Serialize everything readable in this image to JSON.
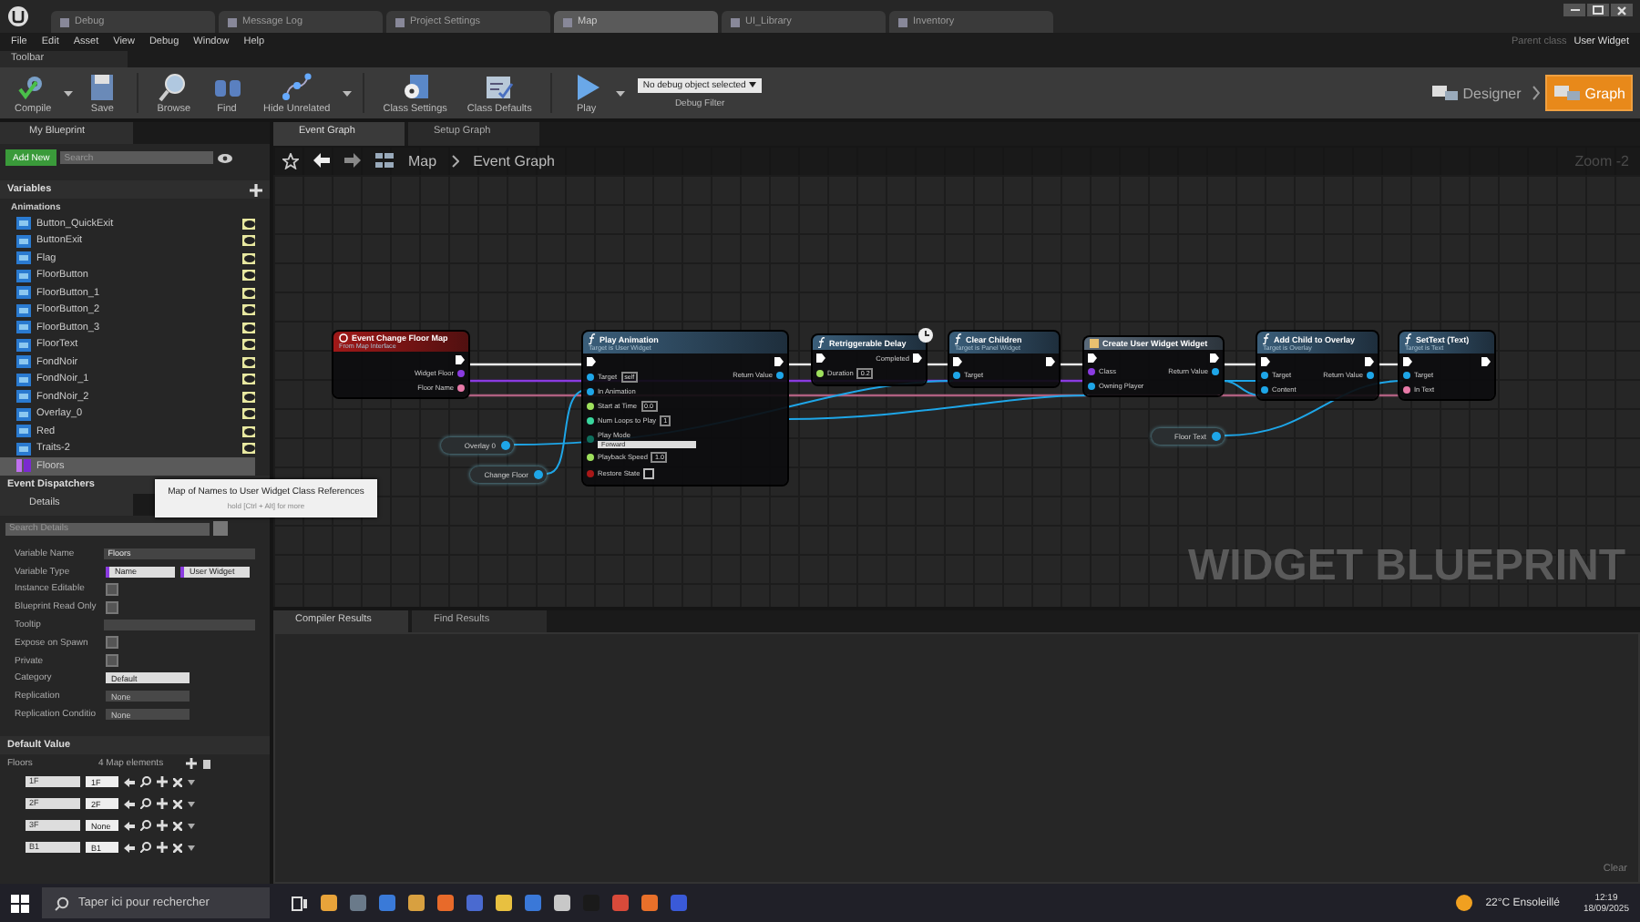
{
  "tabs": [
    {
      "label": "Debug",
      "selected": false
    },
    {
      "label": "Message Log",
      "selected": false
    },
    {
      "label": "Project Settings",
      "selected": false
    },
    {
      "label": "Map",
      "selected": true
    },
    {
      "label": "UI_Library",
      "selected": false
    },
    {
      "label": "Inventory",
      "selected": false
    }
  ],
  "menu": [
    "File",
    "Edit",
    "Asset",
    "View",
    "Debug",
    "Window",
    "Help"
  ],
  "parent_class": {
    "label": "Parent class",
    "value": "User Widget"
  },
  "toolbar": {
    "title": "Toolbar",
    "buttons": [
      {
        "label": "Compile",
        "kind": "compile",
        "dropdown": true
      },
      {
        "label": "Save",
        "kind": "save",
        "dropdown": false
      },
      {
        "label": "Browse",
        "kind": "browse",
        "dropdown": false
      },
      {
        "label": "Find",
        "kind": "find",
        "dropdown": false
      },
      {
        "label": "Hide Unrelated",
        "kind": "hide",
        "dropdown": true
      },
      {
        "label": "Class Settings",
        "kind": "settings",
        "dropdown": false
      },
      {
        "label": "Class Defaults",
        "kind": "defaults",
        "dropdown": false
      },
      {
        "label": "Play",
        "kind": "play",
        "dropdown": true
      }
    ],
    "debug_filter": {
      "value": "No debug object selected",
      "label": "Debug Filter"
    },
    "modes": [
      {
        "label": "Designer",
        "selected": false
      },
      {
        "label": "Graph",
        "selected": true
      }
    ]
  },
  "my_blueprint": {
    "title": "My Blueprint",
    "add_new": "Add New",
    "search": {
      "placeholder": "Search"
    },
    "variables_title": "Variables",
    "category": "Animations",
    "variables": [
      {
        "name": "Button_QuickExit",
        "kind": "widget",
        "exposed": true,
        "selected": false
      },
      {
        "name": "ButtonExit",
        "kind": "widget",
        "exposed": true,
        "selected": false
      },
      {
        "name": "Flag",
        "kind": "widget",
        "exposed": true,
        "selected": false
      },
      {
        "name": "FloorButton",
        "kind": "widget",
        "exposed": true,
        "selected": false
      },
      {
        "name": "FloorButton_1",
        "kind": "widget",
        "exposed": true,
        "selected": false
      },
      {
        "name": "FloorButton_2",
        "kind": "widget",
        "exposed": true,
        "selected": false
      },
      {
        "name": "FloorButton_3",
        "kind": "widget",
        "exposed": true,
        "selected": false
      },
      {
        "name": "FloorText",
        "kind": "widget",
        "exposed": true,
        "selected": false
      },
      {
        "name": "FondNoir",
        "kind": "widget",
        "exposed": true,
        "selected": false
      },
      {
        "name": "FondNoir_1",
        "kind": "widget",
        "exposed": true,
        "selected": false
      },
      {
        "name": "FondNoir_2",
        "kind": "widget",
        "exposed": true,
        "selected": false
      },
      {
        "name": "Overlay_0",
        "kind": "widget",
        "exposed": true,
        "selected": false
      },
      {
        "name": "Red",
        "kind": "widget",
        "exposed": true,
        "selected": false
      },
      {
        "name": "Traits-2",
        "kind": "widget",
        "exposed": true,
        "selected": false
      },
      {
        "name": "Floors",
        "kind": "map",
        "exposed": false,
        "selected": true
      }
    ],
    "event_dispatchers": "Event Dispatchers"
  },
  "tooltip": {
    "title": "Map of Names to User Widget Class References",
    "hint": "hold [Ctrl + Alt] for more"
  },
  "details": {
    "title": "Details",
    "search": {
      "placeholder": "Search Details"
    },
    "properties": [
      {
        "label": "Variable Name",
        "kind": "text",
        "value": "Floors"
      },
      {
        "label": "Variable Type",
        "kind": "type",
        "value": "Name",
        "value2": "User Widget"
      },
      {
        "label": "Instance Editable",
        "kind": "checkbox",
        "checked": false
      },
      {
        "label": "Blueprint Read Only",
        "kind": "checkbox",
        "checked": false
      },
      {
        "label": "Tooltip",
        "kind": "text"
      },
      {
        "label": "Expose on Spawn",
        "kind": "checkbox",
        "checked": false
      },
      {
        "label": "Private",
        "kind": "checkbox",
        "checked": false
      },
      {
        "label": "Category",
        "kind": "dropdown",
        "value": "Default",
        "disabled": false
      },
      {
        "label": "Replication",
        "kind": "dropdown",
        "value": "None",
        "disabled": true
      },
      {
        "label": "Replication Conditio",
        "kind": "dropdown",
        "value": "None",
        "disabled": true
      }
    ],
    "default_value": {
      "title": "Default Value",
      "name": "Floors",
      "count": "4 Map elements",
      "entries": [
        {
          "key": "1F",
          "value": "1F"
        },
        {
          "key": "2F",
          "value": "2F"
        },
        {
          "key": "3F",
          "value": "None"
        },
        {
          "key": "B1",
          "value": "B1"
        }
      ]
    }
  },
  "graph": {
    "tabs": [
      {
        "label": "Event Graph",
        "selected": true
      },
      {
        "label": "Setup Graph",
        "selected": false
      }
    ],
    "breadcrumb": [
      "Map",
      "Event Graph"
    ],
    "zoom": "Zoom -2",
    "watermark": "WIDGET BLUEPRINT",
    "nodes": [
      {
        "kind": "event",
        "title": "Event Change Floor Map",
        "subtitle": "From Map Interface",
        "outputs": [
          {
            "kind": "exec"
          },
          {
            "kind": "data",
            "label": "Widget Floor",
            "color": "#8a3be0"
          },
          {
            "kind": "data",
            "label": "Floor Name",
            "color": "#e87aa8"
          }
        ]
      },
      {
        "kind": "function",
        "title": "Play Animation",
        "subtitle": "Target is User Widget",
        "inputs": [
          {
            "kind": "exec"
          },
          {
            "kind": "data",
            "label": "Target",
            "value": "self",
            "color": "#1ea6e8"
          },
          {
            "kind": "data",
            "label": "In Animation",
            "color": "#1ea6e8"
          },
          {
            "kind": "data",
            "label": "Start at Time",
            "value": "0.0",
            "color": "#9ee05c"
          },
          {
            "kind": "data",
            "label": "Num Loops to Play",
            "value": "1",
            "color": "#3ad69e"
          },
          {
            "kind": "dropdown",
            "label": "Play Mode",
            "value": "Forward",
            "color": "#0e6e5c"
          },
          {
            "kind": "data",
            "label": "Playback Speed",
            "value": "1.0",
            "color": "#9ee05c"
          },
          {
            "kind": "checkbox",
            "label": "Restore State",
            "checked": false,
            "color": "#a81818"
          }
        ],
        "outputs": [
          {
            "kind": "exec"
          },
          {
            "kind": "data",
            "label": "Return Value",
            "color": "#1ea6e8"
          }
        ]
      },
      {
        "kind": "latent",
        "title": "Retriggerable Delay",
        "inputs": [
          {
            "kind": "exec"
          },
          {
            "kind": "data",
            "label": "Duration",
            "value": "0.2",
            "color": "#9ee05c"
          }
        ],
        "outputs": [
          {
            "kind": "exec",
            "label": "Completed"
          }
        ]
      },
      {
        "kind": "function",
        "title": "Clear Children",
        "subtitle": "Target is Panel Widget",
        "inputs": [
          {
            "kind": "exec"
          },
          {
            "kind": "data",
            "label": "Target",
            "color": "#1ea6e8"
          }
        ],
        "outputs": [
          {
            "kind": "exec"
          }
        ]
      },
      {
        "kind": "create",
        "title": "Create User Widget Widget",
        "inputs": [
          {
            "kind": "exec"
          },
          {
            "kind": "data",
            "label": "Class",
            "color": "#8a3be0"
          },
          {
            "kind": "data",
            "label": "Owning Player",
            "color": "#1ea6e8"
          }
        ],
        "outputs": [
          {
            "kind": "exec"
          },
          {
            "kind": "data",
            "label": "Return Value",
            "color": "#1ea6e8"
          }
        ]
      },
      {
        "kind": "function",
        "title": "Add Child to Overlay",
        "subtitle": "Target is Overlay",
        "inputs": [
          {
            "kind": "exec"
          },
          {
            "kind": "data",
            "label": "Target",
            "color": "#1ea6e8"
          },
          {
            "kind": "data",
            "label": "Content",
            "color": "#1ea6e8"
          }
        ],
        "outputs": [
          {
            "kind": "exec"
          },
          {
            "kind": "data",
            "label": "Return Value",
            "color": "#1ea6e8"
          }
        ]
      },
      {
        "kind": "function",
        "title": "SetText (Text)",
        "subtitle": "Target is Text",
        "inputs": [
          {
            "kind": "exec"
          },
          {
            "kind": "data",
            "label": "Target",
            "color": "#1ea6e8"
          },
          {
            "kind": "data",
            "label": "In Text",
            "color": "#e87aa8"
          }
        ],
        "outputs": [
          {
            "kind": "exec"
          }
        ]
      },
      {
        "kind": "variable",
        "title": "Overlay 0",
        "outputs": [
          {
            "kind": "data",
            "color": "#1ea6e8"
          }
        ]
      },
      {
        "kind": "variable",
        "title": "Change Floor",
        "outputs": [
          {
            "kind": "data",
            "color": "#1ea6e8"
          }
        ]
      },
      {
        "kind": "variable",
        "title": "Floor Text",
        "outputs": [
          {
            "kind": "data",
            "color": "#1ea6e8"
          }
        ]
      }
    ]
  },
  "results": {
    "tabs": [
      {
        "label": "Compiler Results",
        "selected": true
      },
      {
        "label": "Find Results",
        "selected": false
      }
    ],
    "clear": "Clear"
  },
  "taskbar": {
    "search": {
      "placeholder": "Taper ici pour rechercher"
    },
    "weather": "22°C Ensoleillé",
    "time": "12:19",
    "date": "18/09/2025"
  }
}
